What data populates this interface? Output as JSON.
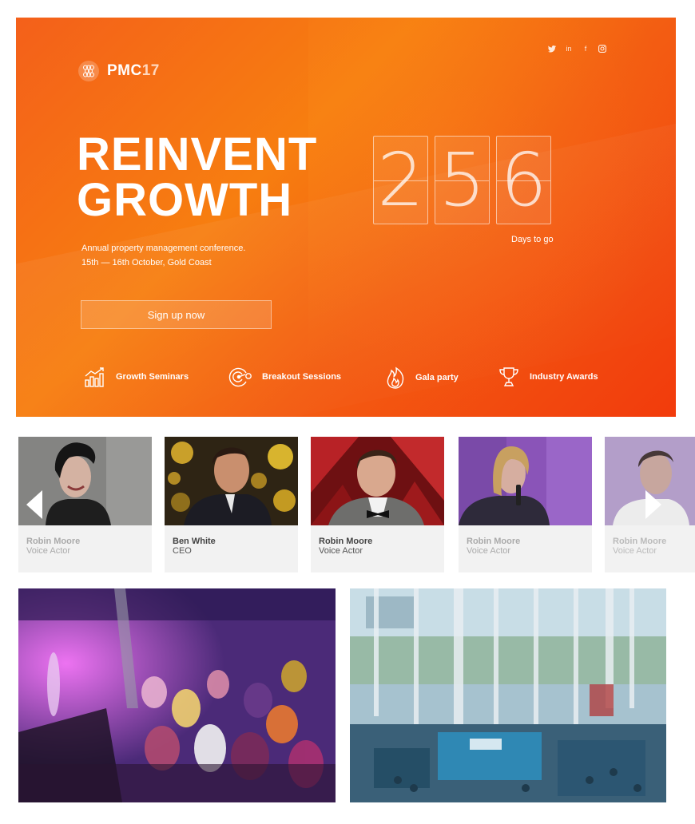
{
  "brand": {
    "logo_main": "PMC",
    "logo_suffix": "17"
  },
  "social": [
    {
      "icon": "twitter-icon",
      "glyph": "🐦"
    },
    {
      "icon": "linkedin-icon",
      "glyph": "in"
    },
    {
      "icon": "facebook-icon",
      "glyph": "f"
    },
    {
      "icon": "instagram-icon",
      "glyph": "▣"
    }
  ],
  "hero": {
    "headline_line1": "REINVENT",
    "headline_line2": "GROWTH",
    "subtitle_line1": "Annual property management conference.",
    "subtitle_line2": "15th — 16th October, Gold Coast",
    "cta_label": "Sign up now",
    "countdown_digits": [
      "2",
      "5",
      "6"
    ],
    "countdown_caption": "Days to go"
  },
  "features": [
    {
      "icon": "growth-chart-icon",
      "label": "Growth Seminars"
    },
    {
      "icon": "target-icon",
      "label": "Breakout Sessions"
    },
    {
      "icon": "flame-icon",
      "label": "Gala party"
    },
    {
      "icon": "trophy-icon",
      "label": "Industry Awards"
    }
  ],
  "speakers": [
    {
      "name": "Robin Moore",
      "role": "Voice Actor"
    },
    {
      "name": "Ben White",
      "role": "CEO"
    },
    {
      "name": "Robin Moore",
      "role": "Voice Actor"
    },
    {
      "name": "Robin Moore",
      "role": "Voice Actor"
    },
    {
      "name": "Robin Moore",
      "role": "Voice Actor"
    }
  ],
  "colors": {
    "hero_orange": "#f77e10",
    "hero_red": "#f23b0c",
    "card_bg": "#f2f2f2"
  }
}
